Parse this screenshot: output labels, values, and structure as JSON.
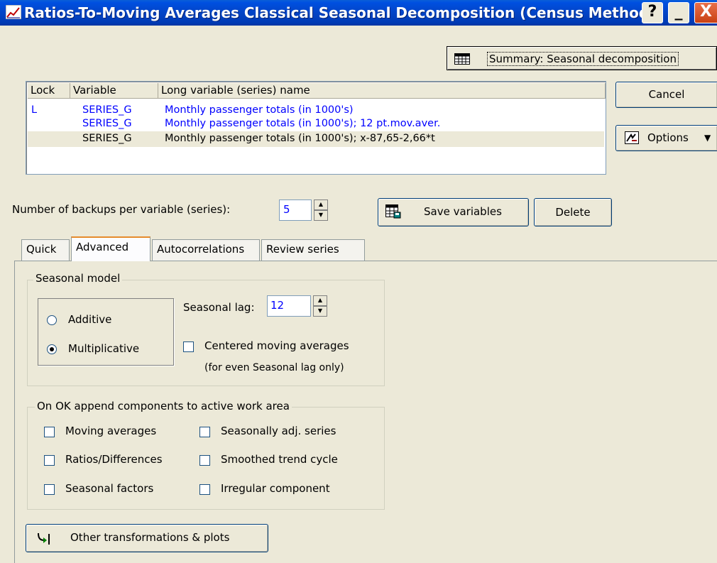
{
  "window": {
    "title": "Ratios-To-Moving Averages Classical Seasonal Decomposition (Census Method",
    "help_glyph": "?",
    "minimize_glyph": "_",
    "close_glyph": "X"
  },
  "summary_button": {
    "label": "Summary: Seasonal decomposition"
  },
  "variable_list": {
    "headers": [
      "Lock",
      "Variable",
      "Long variable (series) name"
    ],
    "rows": [
      {
        "lock": "L",
        "variable": "SERIES_G",
        "name": "Monthly passenger totals (in 1000's)",
        "color": "#0000ff"
      },
      {
        "lock": "",
        "variable": "SERIES_G",
        "name": "Monthly passenger totals (in 1000's); 12 pt.mov.aver.",
        "color": "#0000ff"
      },
      {
        "lock": "",
        "variable": "SERIES_G",
        "name": "Monthly passenger totals (in 1000's); x-87,65-2,66*t",
        "color": "#000000"
      }
    ]
  },
  "side_buttons": {
    "cancel": "Cancel",
    "options": "Options"
  },
  "backups": {
    "label": "Number of backups per variable (series):",
    "value": "5"
  },
  "actions": {
    "save": "Save variables",
    "delete": "Delete"
  },
  "tabs": [
    {
      "label": "Quick"
    },
    {
      "label": "Advanced"
    },
    {
      "label": "Autocorrelations"
    },
    {
      "label": "Review series"
    }
  ],
  "seasonal_model": {
    "title": "Seasonal model",
    "additive": "Additive",
    "multiplicative": "Multiplicative",
    "lag_label": "Seasonal lag:",
    "lag_value": "12",
    "centered_label": "Centered moving averages",
    "centered_note": "(for even Seasonal lag only)"
  },
  "append_components": {
    "title": "On OK append components to active work area",
    "items": [
      "Moving averages",
      "Ratios/Differences",
      "Seasonal factors",
      "Seasonally adj. series",
      "Smoothed trend cycle",
      "Irregular component"
    ]
  },
  "other_button": {
    "label": "Other transformations & plots"
  },
  "colors": {
    "titlebar": "#0244c7",
    "accent_blue": "#0000ff",
    "tab_highlight": "#e68b2c"
  }
}
